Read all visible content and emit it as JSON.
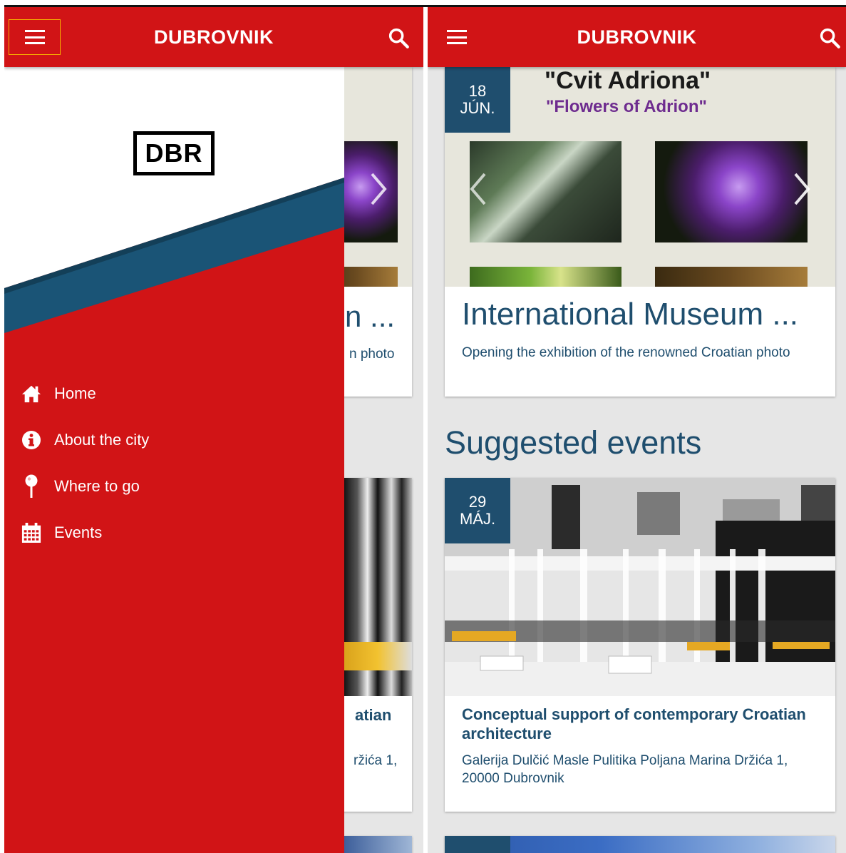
{
  "app": {
    "title": "DUBROVNIK"
  },
  "drawer": {
    "logo_text": "DBR",
    "items": [
      {
        "label": "Home",
        "icon": "home-icon"
      },
      {
        "label": "About the city",
        "icon": "info-icon"
      },
      {
        "label": "Where to go",
        "icon": "map-pin-icon"
      },
      {
        "label": "Events",
        "icon": "calendar-icon"
      }
    ]
  },
  "events": {
    "featured": {
      "date_day": "18",
      "date_month": "JÚN.",
      "poster_title": "\"Cvit Adriona\"",
      "poster_subtitle": "\"Flowers of Adrion\"",
      "title": "International Museum ...",
      "description": "Opening the exhibition of the renowned Croatian photo"
    },
    "suggested_heading": "Suggested events",
    "suggested": [
      {
        "date_day": "29",
        "date_month": "MÁJ.",
        "title": "Conceptual support of contemporary Croatian architecture",
        "location": "Galerija Dulčić Masle Pulitika Poljana Marina Držića 1, 20000 Dubrovnik"
      }
    ]
  },
  "left_peek": {
    "featured_title": "n ...",
    "featured_desc": "n photo",
    "suggested_title": "atian",
    "suggested_loc": "ržića 1,"
  },
  "colors": {
    "brand_red": "#d11416",
    "navy": "#1f4e6e",
    "teal_band": "#1a5476"
  }
}
